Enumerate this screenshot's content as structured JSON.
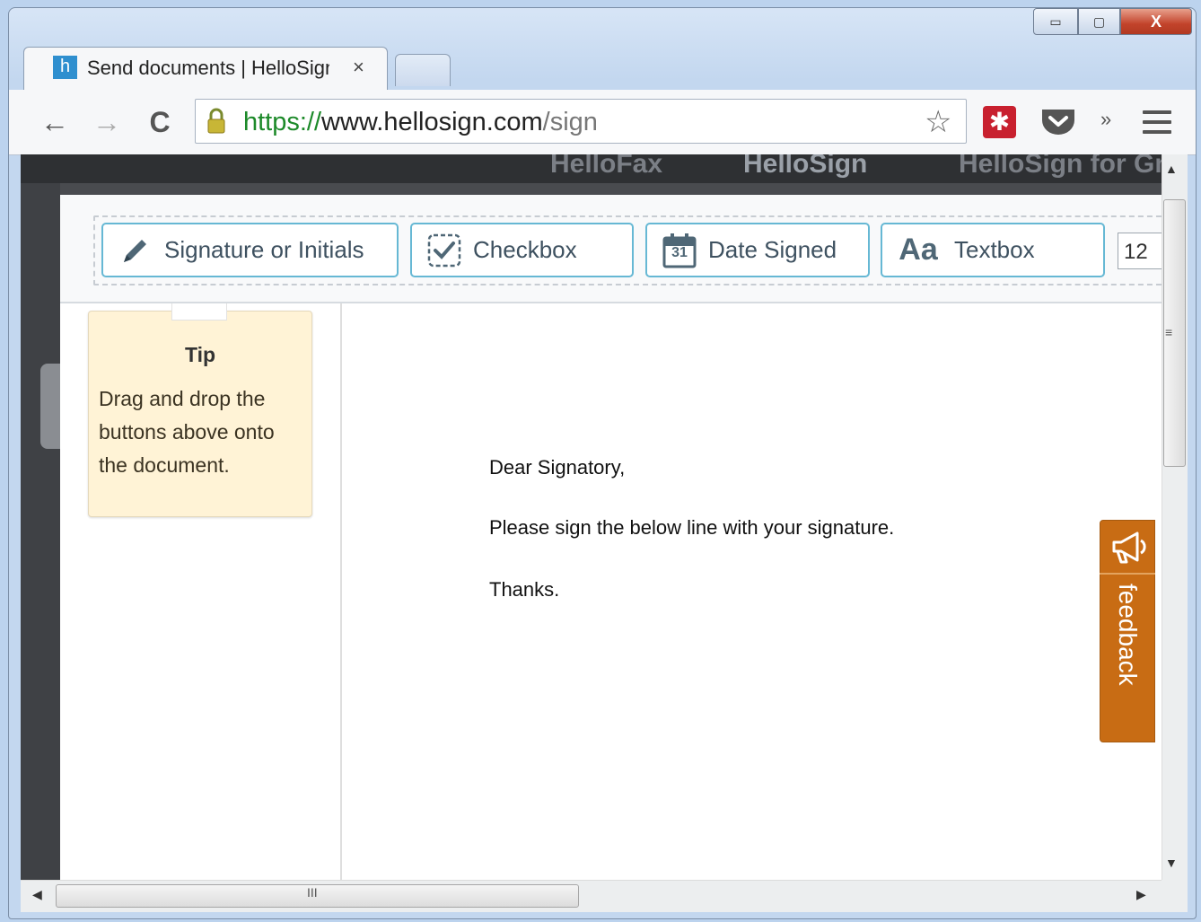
{
  "window": {
    "minimize_glyph": "▭",
    "maximize_glyph": "▢",
    "close_glyph": "X"
  },
  "tab": {
    "favicon_letter": "h",
    "title": "Send documents | HelloSign",
    "close_glyph": "×"
  },
  "nav": {
    "back_glyph": "←",
    "forward_glyph": "→",
    "reload_glyph": "C"
  },
  "omnibox": {
    "scheme": "https://",
    "host": "www.hellosign.com",
    "path": "/sign"
  },
  "toolbar_icons": [
    "star-icon",
    "lastpass-icon",
    "pocket-icon",
    "chevron-overflow-icon",
    "menu-icon"
  ],
  "overflow_glyph": "»",
  "star_glyph": "☆",
  "lastpass_glyph": "✱",
  "site_nav": [
    "HelloFax",
    "HelloSign",
    "HelloSign for Gmail"
  ],
  "editor": {
    "tools": [
      {
        "label": "Signature or Initials",
        "icon": "pencil-icon"
      },
      {
        "label": "Checkbox",
        "icon": "checkbox-icon"
      },
      {
        "label": "Date Signed",
        "icon": "calendar-icon",
        "icon_text": "31"
      },
      {
        "label": "Textbox",
        "icon": "text-icon",
        "icon_text": "Aa"
      }
    ],
    "font_size": "12"
  },
  "tip": {
    "title": "Tip",
    "body": "Drag and drop the buttons above onto the document."
  },
  "document": {
    "lines": [
      "Dear Signatory,",
      "Please sign the below line with your signature.",
      "Thanks."
    ]
  },
  "feedback": {
    "label": "feedback",
    "color": "#c86c14"
  },
  "scrollbar": {
    "grip_h": "III",
    "grip_v": "≡",
    "up": "▲",
    "down": "▼",
    "left": "◀",
    "right": "▶"
  },
  "colors": {
    "accent": "#66b8d4",
    "tip_bg": "#fff3d6",
    "url_scheme": "#1d8a2a"
  }
}
